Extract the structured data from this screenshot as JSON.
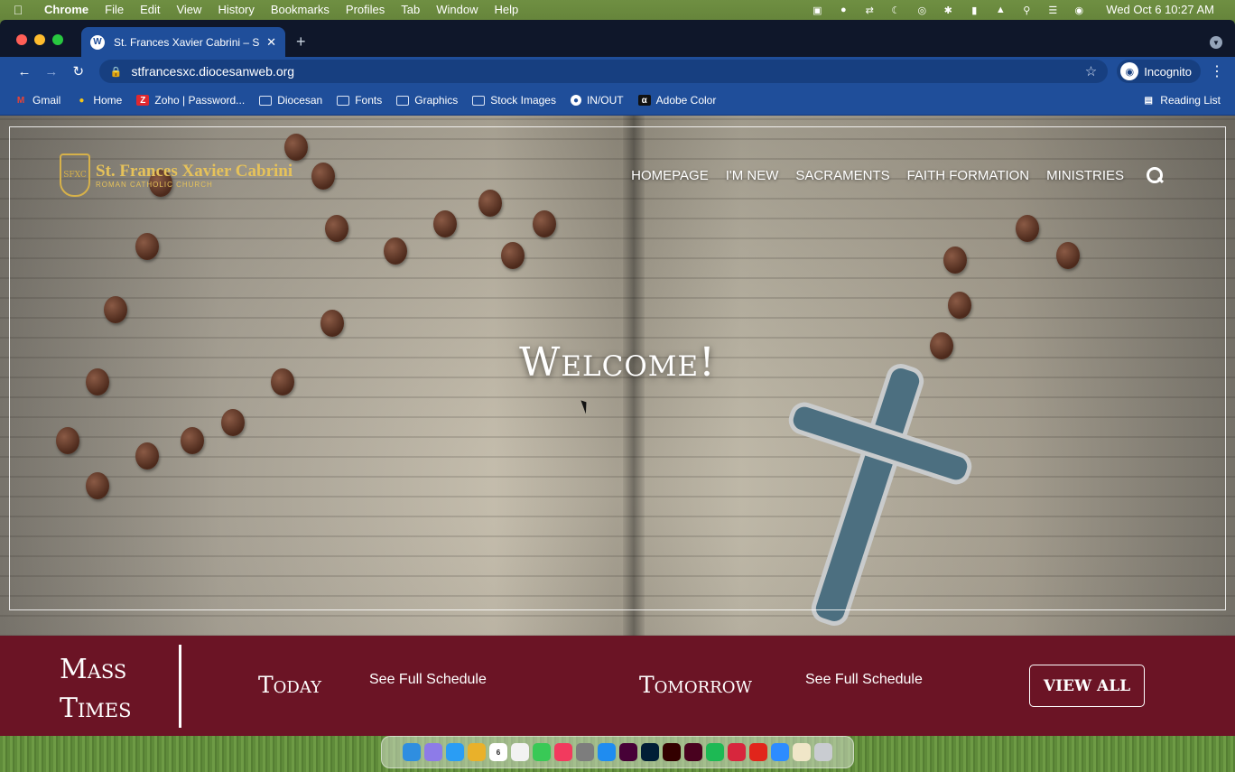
{
  "menubar": {
    "app": "Chrome",
    "items": [
      "File",
      "Edit",
      "View",
      "History",
      "Bookmarks",
      "Profiles",
      "Tab",
      "Window",
      "Help"
    ],
    "datetime": "Wed Oct 6  10:27 AM"
  },
  "browser": {
    "tab_title": "St. Frances Xavier Cabrini – Sp",
    "url": "stfrancesxc.diocesanweb.org",
    "profile": "Incognito",
    "reading_list": "Reading List",
    "bookmarks": [
      {
        "label": "Gmail",
        "icon": "gmail-icon",
        "color": "#ea4335"
      },
      {
        "label": "Home",
        "icon": "home-icon",
        "color": "#f5c518"
      },
      {
        "label": "Zoho | Password...",
        "icon": "zoho-icon",
        "color": "#e0282f"
      },
      {
        "label": "Diocesan",
        "icon": "folder-icon",
        "color": ""
      },
      {
        "label": "Fonts",
        "icon": "folder-icon",
        "color": ""
      },
      {
        "label": "Graphics",
        "icon": "folder-icon",
        "color": ""
      },
      {
        "label": "Stock Images",
        "icon": "folder-icon",
        "color": ""
      },
      {
        "label": "IN/OUT",
        "icon": "clock-icon",
        "color": "#ffffff"
      },
      {
        "label": "Adobe Color",
        "icon": "adobe-color-icon",
        "color": "#111111"
      }
    ]
  },
  "site": {
    "logo_name": "St. Frances Xavier Cabrini",
    "logo_sub": "ROMAN CATHOLIC CHURCH",
    "logo_mark": "SFXC",
    "nav": [
      "HOMEPAGE",
      "I'M NEW",
      "SACRAMENTS",
      "FAITH FORMATION",
      "MINISTRIES"
    ],
    "welcome": "Welcome!",
    "mass_title": "Mass Times",
    "today_label": "Today",
    "today_link": "See Full Schedule",
    "tomorrow_label": "Tomorrow",
    "tomorrow_link": "See Full Schedule",
    "view_all": "VIEW ALL",
    "accent_color": "#6b1425",
    "logo_color": "#e6c25a"
  },
  "dock": {
    "calendar_day": "6",
    "apps": [
      {
        "name": "finder-icon",
        "color": "#2f8ee0"
      },
      {
        "name": "launchpad-icon",
        "color": "#8d7be8"
      },
      {
        "name": "safari-icon",
        "color": "#2a9df4"
      },
      {
        "name": "chrome-icon",
        "color": "#e9b12a"
      },
      {
        "name": "calendar-icon",
        "color": "#ffffff"
      },
      {
        "name": "reminders-icon",
        "color": "#f2f2f2"
      },
      {
        "name": "messages-icon",
        "color": "#39c956"
      },
      {
        "name": "music-icon",
        "color": "#f23a5e"
      },
      {
        "name": "settings-icon",
        "color": "#7d7d7d"
      },
      {
        "name": "app-store-icon",
        "color": "#1f8cf0"
      },
      {
        "name": "adobe-xd-icon",
        "color": "#470137"
      },
      {
        "name": "lightroom-icon",
        "color": "#001e36"
      },
      {
        "name": "illustrator-icon",
        "color": "#330000"
      },
      {
        "name": "indesign-icon",
        "color": "#49021f"
      },
      {
        "name": "spotify-icon",
        "color": "#1db954"
      },
      {
        "name": "screen-sharing-icon",
        "color": "#d7263d"
      },
      {
        "name": "acrobat-icon",
        "color": "#e1251b"
      },
      {
        "name": "zoom-icon",
        "color": "#2d8cff"
      },
      {
        "name": "preview-icon",
        "color": "#f0e6c8"
      },
      {
        "name": "trash-icon",
        "color": "#c9ccd1"
      }
    ]
  }
}
